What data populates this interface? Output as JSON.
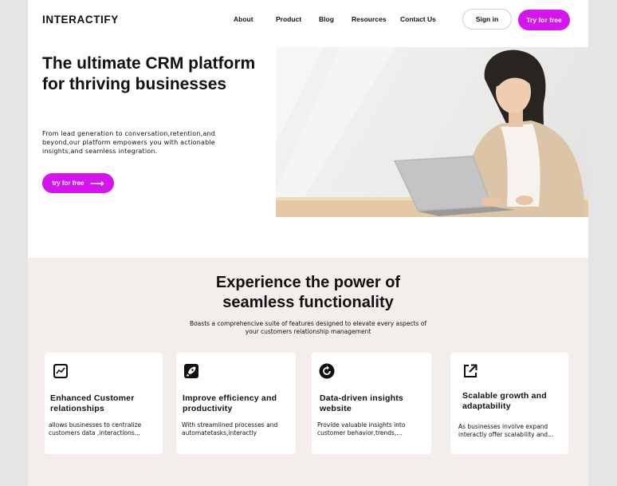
{
  "brand": {
    "logo": "INTERACTIFY",
    "accent": "#d415ee"
  },
  "nav": {
    "links": [
      "About",
      "Product",
      "Blog",
      "Resources",
      "Contact Us"
    ],
    "sign_in": "Sign in",
    "try_free": "Try for free"
  },
  "hero": {
    "title": "The ultimate CRM platform for thriving businesses",
    "description": "From lead generation to conversation,retention,and beyond,our platform empowers you with actionable insights,and seamless integration.",
    "cta": "try for free",
    "cta_icon": "arrow-right-icon",
    "image": "woman-with-laptop-photo"
  },
  "features": {
    "title": "Experience the power of seamless functionality",
    "subtitle": "Boasts a comprehencive suite of features designed to elevate every aspects of your customers relationship management",
    "cards": [
      {
        "icon": "trend-chart-icon",
        "title": "Enhanced Customer relationships",
        "text": "allows businesses to centralize customers data ,interactions..."
      },
      {
        "icon": "rocket-icon",
        "title": "Improve efficiency and productivity",
        "text": "With streamlined processes and automatetasks,interactly"
      },
      {
        "icon": "refresh-circle-icon",
        "title": "Data-driven insights website",
        "text": "Provide valuable insights into customer behavior,trends,..."
      },
      {
        "icon": "external-link-icon",
        "title": "Scalable growth and adaptability",
        "text": "As businesses involve expand interactly offer scalability and..."
      }
    ]
  }
}
